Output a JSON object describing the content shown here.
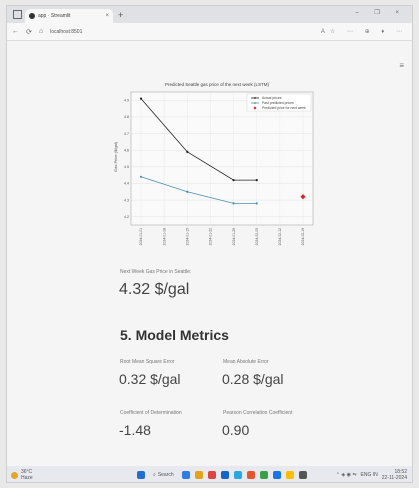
{
  "browser": {
    "tab_title": "app · Streamlit",
    "tab_close": "×",
    "new_tab": "+",
    "window_controls": "– ❐ ×",
    "url": "localhost:8501",
    "nav_back": "←",
    "nav_reload": "⟳",
    "nav_home": "⌂",
    "toolbar_right": "A☆ ⋯ ⊕ ♦ ⋯"
  },
  "page": {
    "menu_icon": "≡",
    "next_week_label": "Next Week Gas Price in Seattle:",
    "next_week_value": "4.32 $/gal",
    "section_title": "5. Model Metrics",
    "metrics": [
      {
        "label": "Root Mean Square Error",
        "value": "0.32 $/gal"
      },
      {
        "label": "Mean Absolute Error",
        "value": "0.28 $/gal"
      },
      {
        "label": "Coefficient of Determination",
        "value": "-1.48"
      },
      {
        "label": "Pearson Correlation Coefficient",
        "value": "0.90"
      }
    ]
  },
  "chart_data": {
    "type": "line",
    "title": "Predicted Seattle gas price of the next week (LSTM)",
    "ylabel": "Gas Price ($/gal)",
    "xlabel": "",
    "ylim": [
      4.15,
      4.95
    ],
    "y_ticks": [
      "4.2",
      "4.3",
      "4.4",
      "4.5",
      "4.6",
      "4.7",
      "4.8",
      "4.9"
    ],
    "x_tick_labels": [
      "2024-01-01",
      "2024-01-08",
      "2024-01-15",
      "2024-01-22",
      "2024-01-29",
      "2024-02-05",
      "2024-02-12",
      "2024-02-19"
    ],
    "grid": true,
    "legend_position": "top-right",
    "series": [
      {
        "name": "Actual prices",
        "color": "#222222",
        "marker": "dot",
        "x_index": [
          0,
          2,
          4,
          5
        ],
        "values": [
          4.91,
          4.59,
          4.42,
          4.42
        ]
      },
      {
        "name": "Past predicted prices",
        "color": "#4a8fb0",
        "marker": "dot",
        "x_index": [
          0,
          2,
          4,
          5
        ],
        "values": [
          4.44,
          4.35,
          4.28,
          4.28
        ]
      },
      {
        "name": "Predicted price for next week",
        "color": "#d62728",
        "marker": "diamond",
        "x_index": [
          7
        ],
        "values": [
          4.32
        ]
      }
    ]
  },
  "taskbar": {
    "weather_temp": "36°C",
    "weather_desc": "Haze",
    "search_label": "Search",
    "tray_lang": "ENG IN",
    "tray_icons": "⌃ ◈ ◉ ⇋",
    "time": "18:52",
    "date": "22-11-2024",
    "icon_colors": [
      "#1f6fd1",
      "#2f7de1",
      "#e3a21a",
      "#d44",
      "#1366c8",
      "#2aa8e0",
      "#e4572e",
      "#3a9f4a",
      "#1a73e8",
      "#fbbc04",
      "#555555"
    ]
  }
}
